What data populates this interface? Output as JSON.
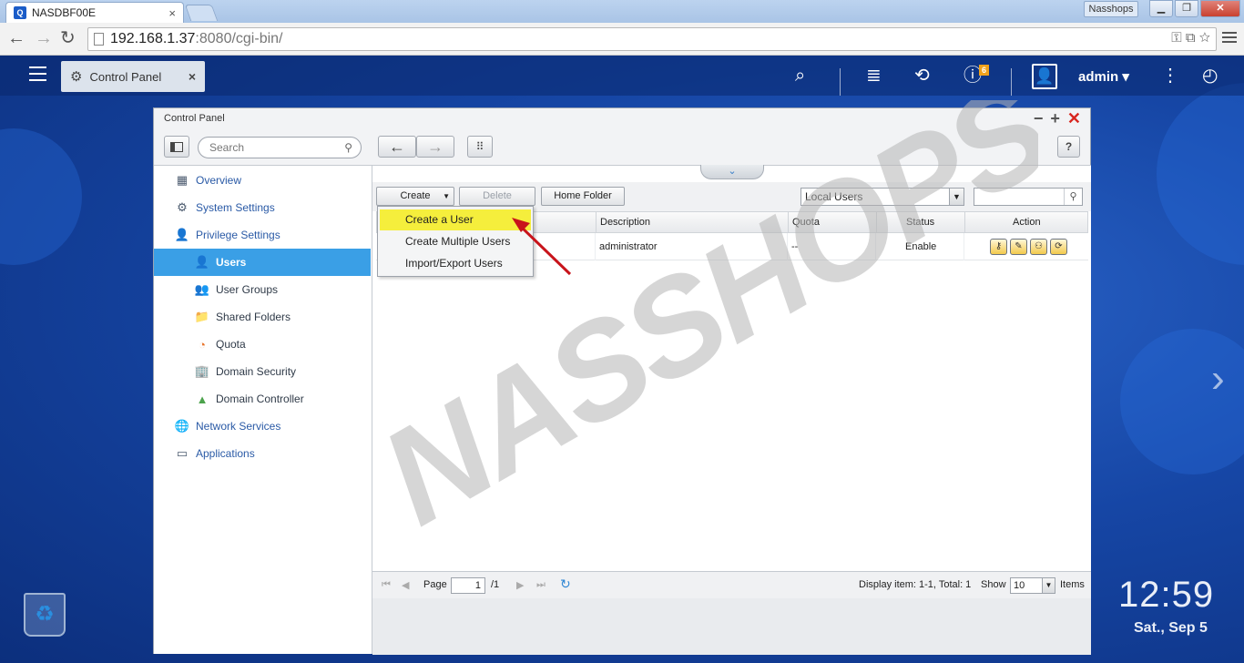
{
  "browser": {
    "tab_title": "NASDBF00E",
    "brand_button": "Nasshops",
    "url_host": "192.168.1.37",
    "url_rest": ":8080/cgi-bin/",
    "back_glyph": "←",
    "forward_glyph": "→",
    "reload_glyph": "↻",
    "close_glyph": "×",
    "win_min": "▁",
    "win_max": "❐",
    "win_close": "✕"
  },
  "desktop": {
    "open_app_tab": "Control Panel",
    "user": "admin ▾",
    "notification_count": "6",
    "clock": "12:59",
    "date": "Sat., Sep 5"
  },
  "window": {
    "title": "Control Panel",
    "search_placeholder": "Search",
    "help": "?"
  },
  "sidebar": {
    "items": [
      {
        "label": "Overview",
        "icon": "grid-icon",
        "glyph": "▦"
      },
      {
        "label": "System Settings",
        "icon": "gear-icon",
        "glyph": "⚙"
      },
      {
        "label": "Privilege Settings",
        "icon": "person-icon",
        "glyph": "👤"
      },
      {
        "label": "Users",
        "icon": "user-icon",
        "glyph": "👤"
      },
      {
        "label": "User Groups",
        "icon": "user-group-icon",
        "glyph": "👥"
      },
      {
        "label": "Shared Folders",
        "icon": "folder-icon",
        "glyph": "📁"
      },
      {
        "label": "Quota",
        "icon": "pie-icon",
        "glyph": "◔"
      },
      {
        "label": "Domain Security",
        "icon": "building-icon",
        "glyph": "🏢"
      },
      {
        "label": "Domain Controller",
        "icon": "triangle-icon",
        "glyph": "▲"
      },
      {
        "label": "Network Services",
        "icon": "globe-icon",
        "glyph": "🌐"
      },
      {
        "label": "Applications",
        "icon": "tray-icon",
        "glyph": "▭"
      }
    ]
  },
  "toolbar": {
    "create_label": "Create",
    "delete_label": "Delete",
    "home_folder_label": "Home Folder",
    "scope_select": "Local Users"
  },
  "dropdown": {
    "items": [
      "Create a User",
      "Create Multiple Users",
      "Import/Export Users"
    ]
  },
  "table": {
    "columns": [
      "Description",
      "Quota",
      "Status",
      "Action"
    ],
    "rows": [
      {
        "description": "administrator",
        "quota": "--",
        "status": "Enable"
      }
    ]
  },
  "pager": {
    "page_label": "Page",
    "page_value": "1",
    "page_total": "/1",
    "display_info": "Display item: 1-1, Total: 1",
    "show_label": "Show",
    "show_value": "10",
    "items_label": "Items"
  },
  "watermark": "NASSHOPS.net",
  "colors": {
    "accent": "#3a9fe6",
    "highlight": "#f5ee3c",
    "arrow": "#c8141b",
    "close": "#d8261f"
  }
}
